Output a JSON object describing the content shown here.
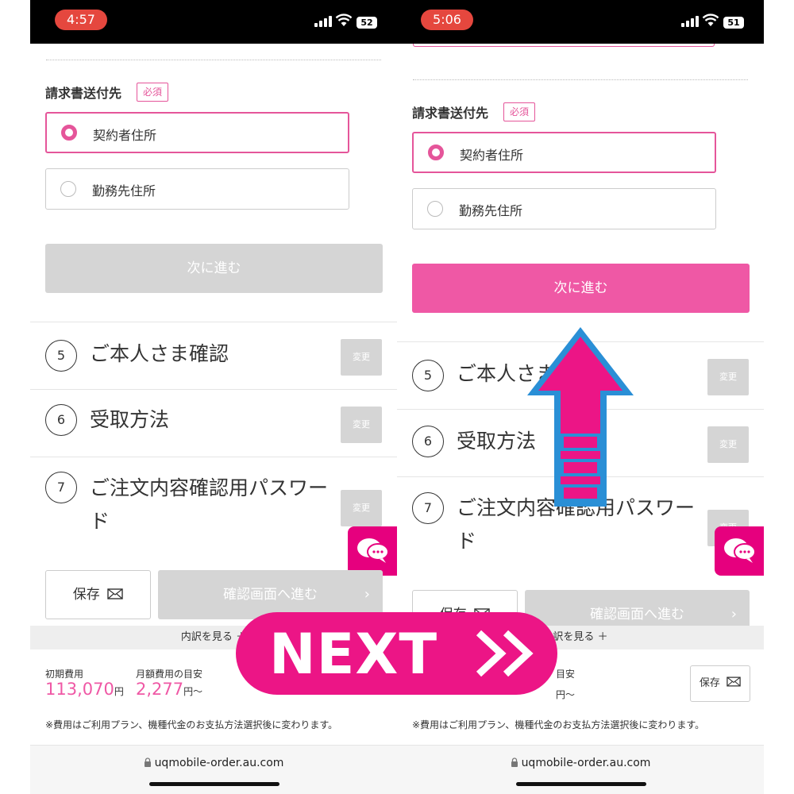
{
  "left": {
    "status": {
      "time": "4:57",
      "battery": "52"
    },
    "section_label": "請求書送付先",
    "required_label": "必須",
    "radio_options": [
      {
        "label": "契約者住所",
        "selected": true
      },
      {
        "label": "勤務先住所",
        "selected": false
      }
    ],
    "next_button": "次に進む",
    "steps": [
      {
        "num": "5",
        "title": "ご本人さま確認",
        "change": "変更"
      },
      {
        "num": "6",
        "title": "受取方法",
        "change": "変更"
      },
      {
        "num": "7",
        "title": "ご注文内容確認用パスワード",
        "change": "変更"
      }
    ],
    "save_label": "保存",
    "confirm_label": "確認画面へ進む",
    "breakdown_label": "内訳を見る",
    "initial_fee_label": "初期費用",
    "initial_fee_value": "113,070",
    "yen": "円",
    "monthly_fee_label": "月額費用の目安",
    "monthly_fee_value": "2,277",
    "monthly_suffix": "円〜",
    "disclaimer": "※費用はご利用プラン、機種代金のお支払方法選択後に変わります。",
    "url": "uqmobile-order.au.com"
  },
  "right": {
    "status": {
      "time": "5:06",
      "battery": "51"
    },
    "section_label": "請求書送付先",
    "required_label": "必須",
    "radio_options": [
      {
        "label": "契約者住所",
        "selected": true
      },
      {
        "label": "勤務先住所",
        "selected": false
      }
    ],
    "next_button": "次に進む",
    "steps": [
      {
        "num": "5",
        "title": "ご本人さま",
        "change": "変更"
      },
      {
        "num": "6",
        "title": "受取方法",
        "change": "変更"
      },
      {
        "num": "7",
        "title": "ご注文内容確認用パスワード",
        "change": "変更"
      }
    ],
    "save_label": "保存",
    "confirm_label": "確認画面へ進む",
    "breakdown_label": "訳を見る",
    "monthly_fee_label": "目安",
    "monthly_suffix": "円〜",
    "disclaimer": "※費用はご利用プラン、機種代金のお支払方法選択後に変わります。",
    "url": "uqmobile-order.au.com"
  },
  "overlay": {
    "next_text": "NEXT",
    "banner_color": "#ec1586",
    "arrow_fill": "#ec1586",
    "arrow_outline": "#2a8fd6"
  },
  "colors": {
    "accent_pink": "#ef58a5",
    "disabled_gray": "#d5d5d5",
    "chat_magenta": "#e6007e"
  },
  "icons": [
    "signal-icon",
    "wifi-icon",
    "battery-icon",
    "chat-icon",
    "envelope-icon",
    "lock-icon",
    "chevron-right-icon",
    "plus-icon",
    "double-chevron-icon",
    "up-arrow-icon"
  ]
}
